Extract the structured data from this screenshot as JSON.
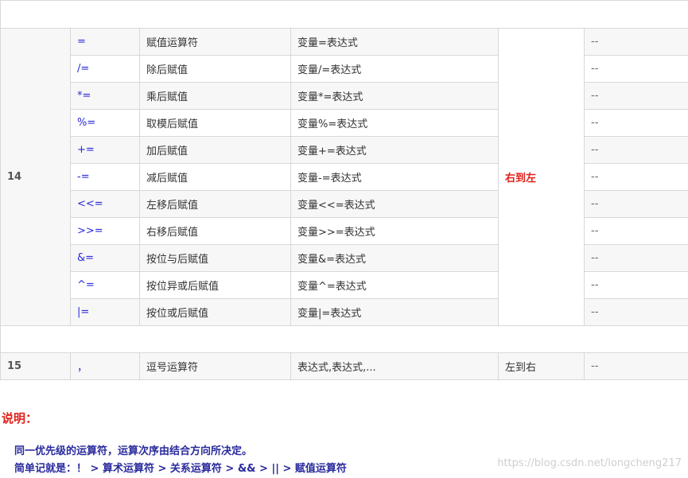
{
  "rows14": [
    {
      "op": "=",
      "name": "赋值运算符",
      "usage": "变量=表达式",
      "other": "--"
    },
    {
      "op": "/=",
      "name": "除后赋值",
      "usage": "变量/=表达式",
      "other": "--"
    },
    {
      "op": "*=",
      "name": "乘后赋值",
      "usage": "变量*=表达式",
      "other": "--"
    },
    {
      "op": "%=",
      "name": "取模后赋值",
      "usage": "变量%=表达式",
      "other": "--"
    },
    {
      "op": "+=",
      "name": "加后赋值",
      "usage": "变量+=表达式",
      "other": "--"
    },
    {
      "op": "-=",
      "name": "减后赋值",
      "usage": "变量-=表达式",
      "other": "--"
    },
    {
      "op": "<<=",
      "name": "左移后赋值",
      "usage": "变量<<=表达式",
      "other": "--"
    },
    {
      "op": ">>=",
      "name": "右移后赋值",
      "usage": "变量>>=表达式",
      "other": "--"
    },
    {
      "op": "&=",
      "name": "按位与后赋值",
      "usage": "变量&=表达式",
      "other": "--"
    },
    {
      "op": "^=",
      "name": "按位异或后赋值",
      "usage": "变量^=表达式",
      "other": "--"
    },
    {
      "op": "|=",
      "name": "按位或后赋值",
      "usage": "变量|=表达式",
      "other": "--"
    }
  ],
  "group14": {
    "priority": "14",
    "associativity": "右到左"
  },
  "row15": {
    "priority": "15",
    "op": "，",
    "name": "逗号运算符",
    "usage": "表达式,表达式,...",
    "associativity": "左到右",
    "other": "--"
  },
  "notes": {
    "title": "说明：",
    "line1": "同一优先级的运算符，运算次序由结合方向所决定。",
    "line2": "简单记就是：！ > 算术运算符 > 关系运算符 > && > || > 赋值运算符"
  },
  "watermark": "https://blog.csdn.net/longcheng217"
}
